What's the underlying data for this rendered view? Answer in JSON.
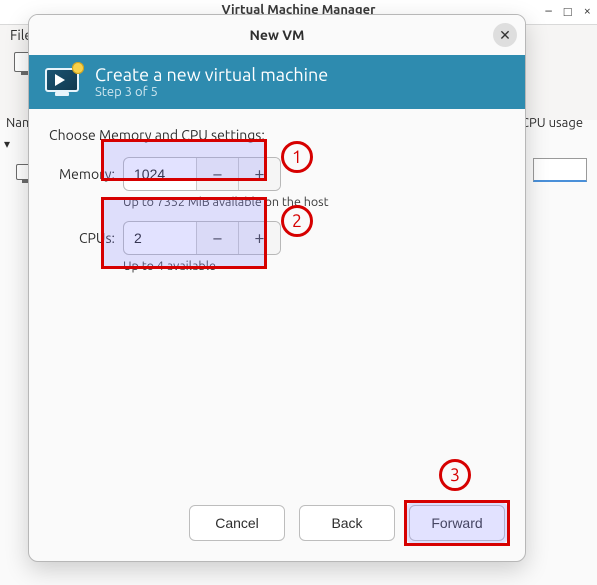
{
  "background": {
    "title": "Virtual Machine Manager",
    "menu_file": "File",
    "row_name": "Name",
    "row_usage": "CPU usage",
    "win_min": "–",
    "win_max": "□",
    "win_close": "×"
  },
  "dialog": {
    "title": "New VM",
    "close_glyph": "✕",
    "header": {
      "title": "Create a new virtual machine",
      "step": "Step 3 of 5"
    },
    "section_title": "Choose Memory and CPU settings:",
    "memory": {
      "label": "Memory:",
      "value": "1024",
      "minus": "−",
      "plus": "+",
      "hint": "Up to 7352 MiB available on the host"
    },
    "cpus": {
      "label": "CPUs:",
      "value": "2",
      "minus": "−",
      "plus": "+",
      "hint": "Up to 4 available"
    },
    "buttons": {
      "cancel": "Cancel",
      "back": "Back",
      "forward": "Forward"
    }
  },
  "annotations": {
    "n1": "1",
    "n2": "2",
    "n3": "3"
  }
}
